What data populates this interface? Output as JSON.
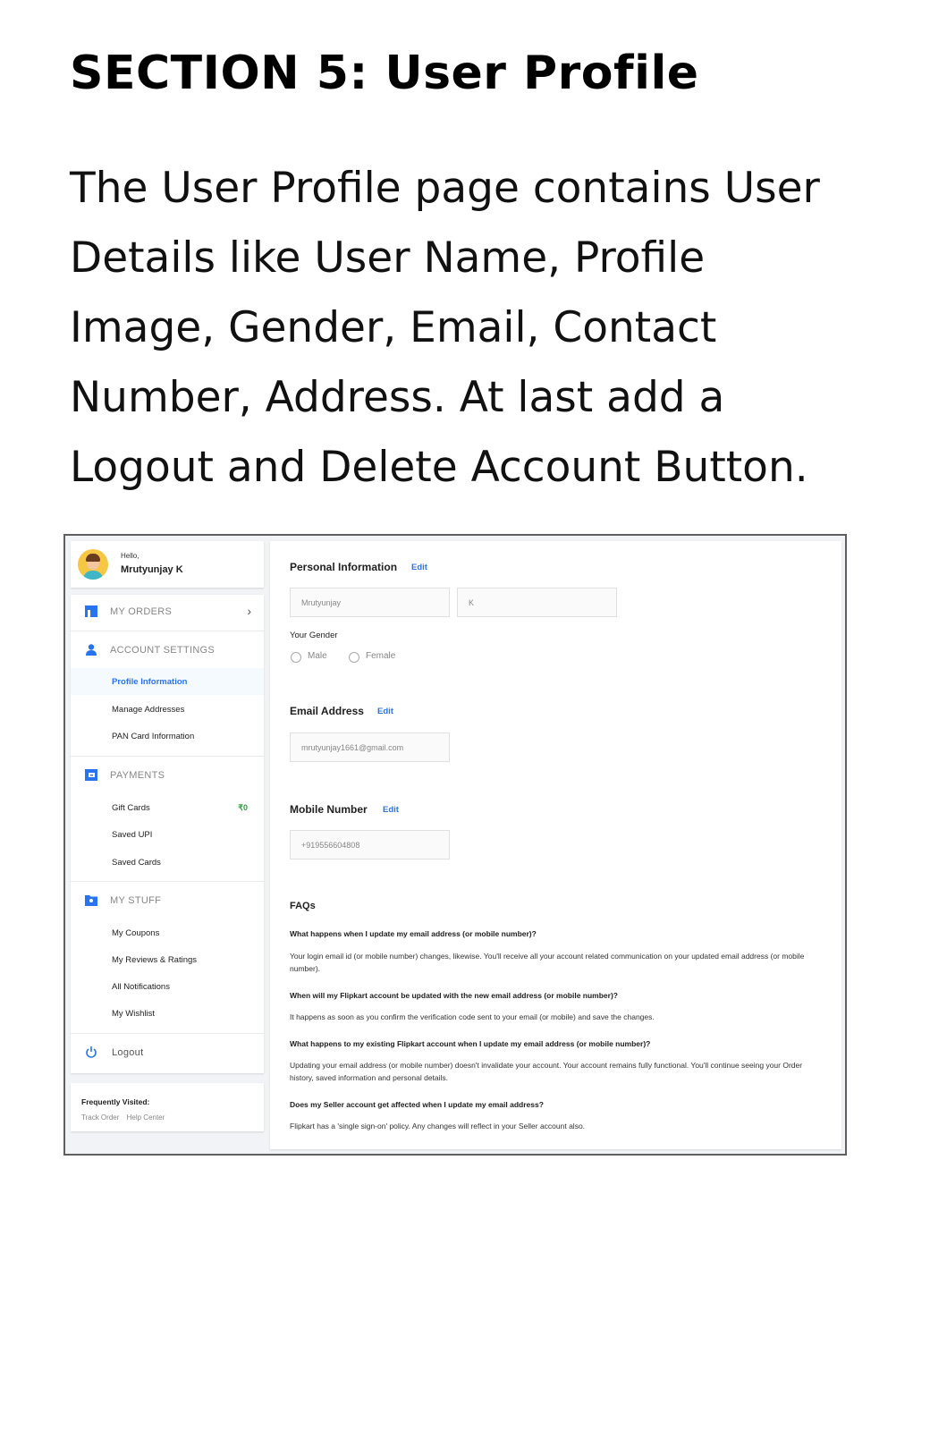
{
  "document": {
    "title": "SECTION 5: User Profile",
    "paragraph": "The User Profile page contains User Details like User Name, Profile Image, Gender, Email, Contact Number, Address. At last add a Logout and Delete Account Button."
  },
  "screenshot": {
    "sidebar": {
      "hello": "Hello,",
      "user_name": "Mrutyunjay K",
      "my_orders": "MY ORDERS",
      "account_settings": "ACCOUNT SETTINGS",
      "account_items": [
        "Profile Information",
        "Manage Addresses",
        "PAN Card Information"
      ],
      "payments": "PAYMENTS",
      "payment_items": [
        "Gift Cards",
        "Saved UPI",
        "Saved Cards"
      ],
      "gift_card_balance": "₹0",
      "my_stuff": "MY STUFF",
      "stuff_items": [
        "My Coupons",
        "My Reviews & Ratings",
        "All Notifications",
        "My Wishlist"
      ],
      "logout": "Logout",
      "frequently_visited": "Frequently Visited:",
      "frequent_links": [
        "Track Order",
        "Help Center"
      ],
      "icons": [
        "orders-icon",
        "person-icon",
        "wallet-icon",
        "folder-icon",
        "power-icon"
      ],
      "accent_color": "#2874f0"
    },
    "main": {
      "personal_information": "Personal Information",
      "edit": "Edit",
      "first_name": "Mrutyunjay",
      "last_name": "K",
      "your_gender": "Your Gender",
      "gender_options": [
        "Male",
        "Female"
      ],
      "email_address": "Email Address",
      "email": "mrutyunjay1661@gmail.com",
      "mobile_number": "Mobile Number",
      "mobile": "+919556604808",
      "faqs": "FAQs",
      "faq": [
        {
          "q": "What happens when I update my email address (or mobile number)?",
          "a": "Your login email id (or mobile number) changes, likewise. You'll receive all your account related communication on your updated email address (or mobile number)."
        },
        {
          "q": "When will my Flipkart account be updated with the new email address (or mobile number)?",
          "a": "It happens as soon as you confirm the verification code sent to your email (or mobile) and save the changes."
        },
        {
          "q": "What happens to my existing Flipkart account when I update my email address (or mobile number)?",
          "a": "Updating your email address (or mobile number) doesn't invalidate your account. Your account remains fully functional. You'll continue seeing your Order history, saved information and personal details."
        },
        {
          "q": "Does my Seller account get affected when I update my email address?",
          "a": "Flipkart has a 'single sign-on' policy. Any changes will reflect in your Seller account also."
        }
      ]
    }
  }
}
